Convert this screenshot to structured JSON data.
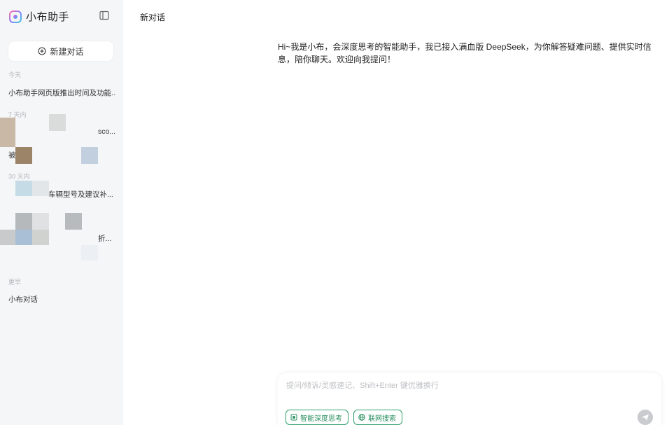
{
  "sidebar": {
    "brand": "小布助手",
    "new_chat_label": "新建对话",
    "groups": [
      {
        "label": "今天"
      },
      {
        "label": "7 天内"
      },
      {
        "label": "30 天内"
      },
      {
        "label": "更早"
      }
    ],
    "items": [
      {
        "label": "小布助手网页版推出时间及功能..."
      },
      {
        "label": "sco..."
      },
      {
        "label": "被"
      },
      {
        "label": "车辆型号及建议补..."
      },
      {
        "label": "折..."
      },
      {
        "label": "小布对话"
      }
    ]
  },
  "main": {
    "title": "新对话",
    "greeting": "Hi~我是小布，会深度思考的智能助手，我已接入满血版 DeepSeek，为你解答疑难问题、提供实时信息，陪你聊天。欢迎向我提问！"
  },
  "composer": {
    "placeholder": "提问/倾诉/灵感速记、Shift+Enter 键优雅换行",
    "deep_think_label": "智能深度思考",
    "web_search_label": "联网搜索"
  },
  "colors": {
    "sidebar_bg": "#f5f6f7",
    "accent_green": "#2fa06b",
    "send_disabled": "#c9cbcf"
  }
}
